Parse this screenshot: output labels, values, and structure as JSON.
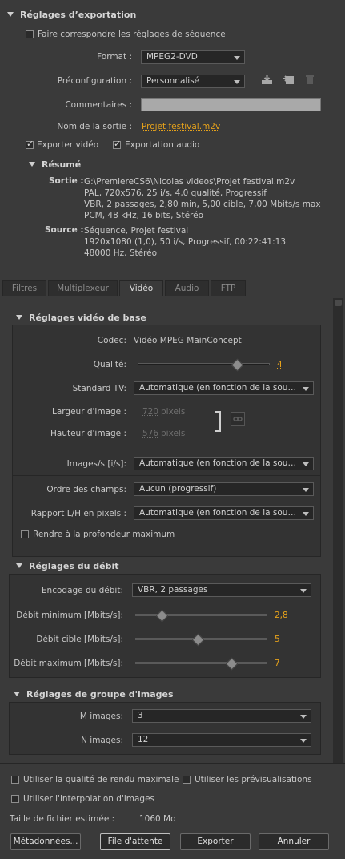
{
  "export_settings": {
    "header": "Réglages d’exportation",
    "match_sequence_label": "Faire correspondre les réglages de séquence",
    "format_label": "Format :",
    "format_value": "MPEG2-DVD",
    "preset_label": "Préconfiguration :",
    "preset_value": "Personnalisé",
    "comments_label": "Commentaires :",
    "comments_value": "",
    "output_name_label": "Nom de la sortie :",
    "output_name_value": "Projet festival.m2v",
    "export_video_label": "Exporter vidéo",
    "export_audio_label": "Exportation audio"
  },
  "summary": {
    "header": "Résumé",
    "output_label": "Sortie :",
    "output_lines": [
      "G:\\PremiereCS6\\Nicolas videos\\Projet festival.m2v",
      "PAL, 720x576, 25 i/s, 4,0 qualité, Progressif",
      "VBR, 2 passages, 2,80 min, 5,00 cible, 7,00 Mbits/s max",
      "PCM, 48 kHz, 16 bits, Stéréo"
    ],
    "source_label": "Source :",
    "source_lines": [
      "Séquence, Projet festival",
      "1920x1080 (1,0), 50  i/s, Progressif, 00:22:41:13",
      "48000 Hz, Stéréo"
    ]
  },
  "tabs": [
    "Filtres",
    "Multiplexeur",
    "Vidéo",
    "Audio",
    "FTP"
  ],
  "basic_video": {
    "header": "Réglages vidéo de base",
    "codec_label": "Codec:",
    "codec_value": "Vidéo MPEG MainConcept",
    "quality_label": "Qualité:",
    "quality_value": "4",
    "tv_standard_label": "Standard TV:",
    "tv_standard_value": "Automatique (en fonction de la source)",
    "width_label": "Largeur d'image :",
    "width_value": "720",
    "height_label": "Hauteur d'image :",
    "height_value": "576",
    "pixels_unit": "pixels",
    "fps_label": "Images/s [i/s]:",
    "fps_value": "Automatique (en fonction de la source)",
    "field_order_label": "Ordre des champs:",
    "field_order_value": "Aucun (progressif)",
    "aspect_label": "Rapport L/H en pixels :",
    "aspect_value": "Automatique (en fonction de la source)",
    "max_depth_label": "Rendre à la profondeur maximum"
  },
  "bitrate": {
    "header": "Réglages du débit",
    "encoding_label": "Encodage du débit:",
    "encoding_value": "VBR, 2 passages",
    "min_label": "Débit minimum [Mbits/s]:",
    "min_value": "2,8",
    "target_label": "Débit cible [Mbits/s]:",
    "target_value": "5",
    "max_label": "Débit maximum [Mbits/s]:",
    "max_value": "7",
    "min_fraction": 0.2,
    "target_fraction": 0.47,
    "max_fraction": 0.73,
    "quality_fraction": 0.75
  },
  "gop": {
    "header": "Réglages de groupe d'images",
    "m_label": "M images:",
    "m_value": "3",
    "n_label": "N images:",
    "n_value": "12"
  },
  "footer": {
    "max_render_quality_label": "Utiliser la qualité de rendu maximale",
    "use_previews_label": "Utiliser les prévisualisations",
    "frame_blending_label": "Utiliser l'interpolation d'images",
    "file_size_label": "Taille de fichier estimée :",
    "file_size_value": "1060 Mo",
    "metadata_button": "Métadonnées...",
    "queue_button": "File d'attente",
    "export_button": "Exporter",
    "cancel_button": "Annuler"
  }
}
